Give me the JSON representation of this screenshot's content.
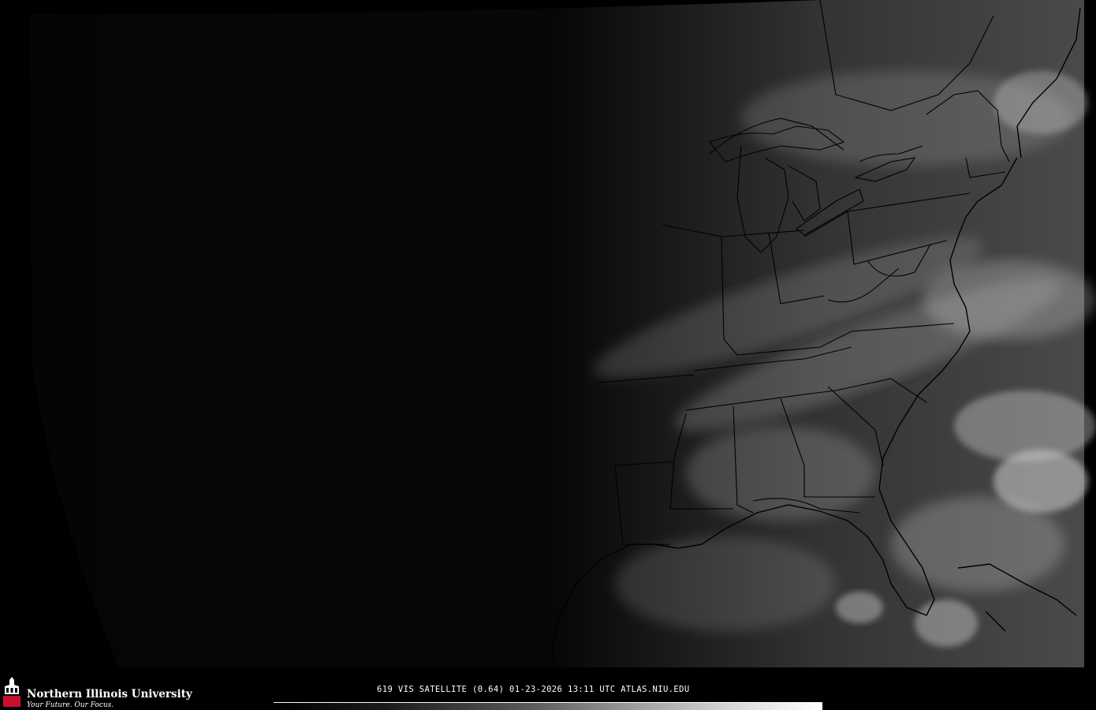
{
  "map": {
    "product": "VIS SATELLITE",
    "caption": "619 VIS SATELLITE (0.64) 01-23-2026 13:11 UTC  ATLAS.NIU.EDU",
    "colors": {
      "background": "#000000",
      "borders": "#000000",
      "cloud": "#d9d9d9"
    }
  },
  "branding": {
    "name": "Northern Illinois University",
    "tagline": "Your Future. Our Focus.",
    "seal_text": "NIU"
  },
  "colorbar": {
    "gradient": "black-to-white"
  }
}
